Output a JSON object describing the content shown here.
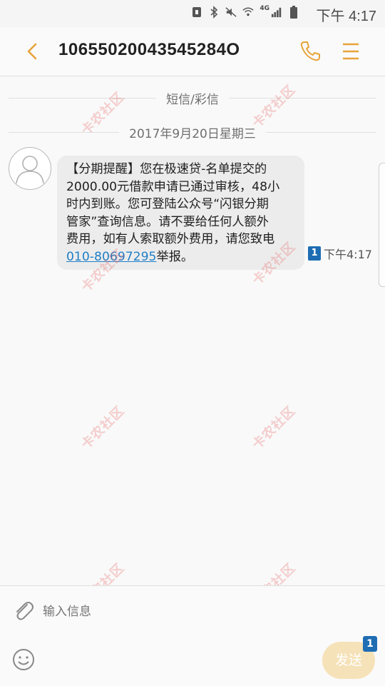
{
  "status_bar": {
    "time": "下午 4:17",
    "network": "4G",
    "icons": [
      "nfc-icon",
      "bluetooth-icon",
      "mute-icon",
      "wifi-icon",
      "signal-icon",
      "battery-icon"
    ]
  },
  "header": {
    "title": "10655020043545284O",
    "icons": [
      "back-arrow-icon",
      "phone-icon",
      "menu-icon"
    ],
    "accent_color": "#e8a33a"
  },
  "separators": {
    "type_label": "短信/彩信",
    "date_label": "2017年9月20日星期三"
  },
  "message": {
    "lines": [
      "【分期提醒】您在极速贷-名单提交的",
      "2000.00元借款申请已通过审核，48小",
      "时内到账。您可登陆公众号“闪银分期",
      "管家”查询信息。请不要给任何人额外",
      "费用，如有人索取额外费用，请您致电"
    ],
    "phone_link": "010-80697295",
    "tail": "举报。",
    "sim": "1",
    "time": "下午4:17"
  },
  "composer": {
    "placeholder": "输入信息",
    "send_label": "发送",
    "send_badge": "1",
    "icons": [
      "attach-icon",
      "emoji-icon"
    ]
  },
  "watermark": {
    "text": "卡农社区"
  }
}
